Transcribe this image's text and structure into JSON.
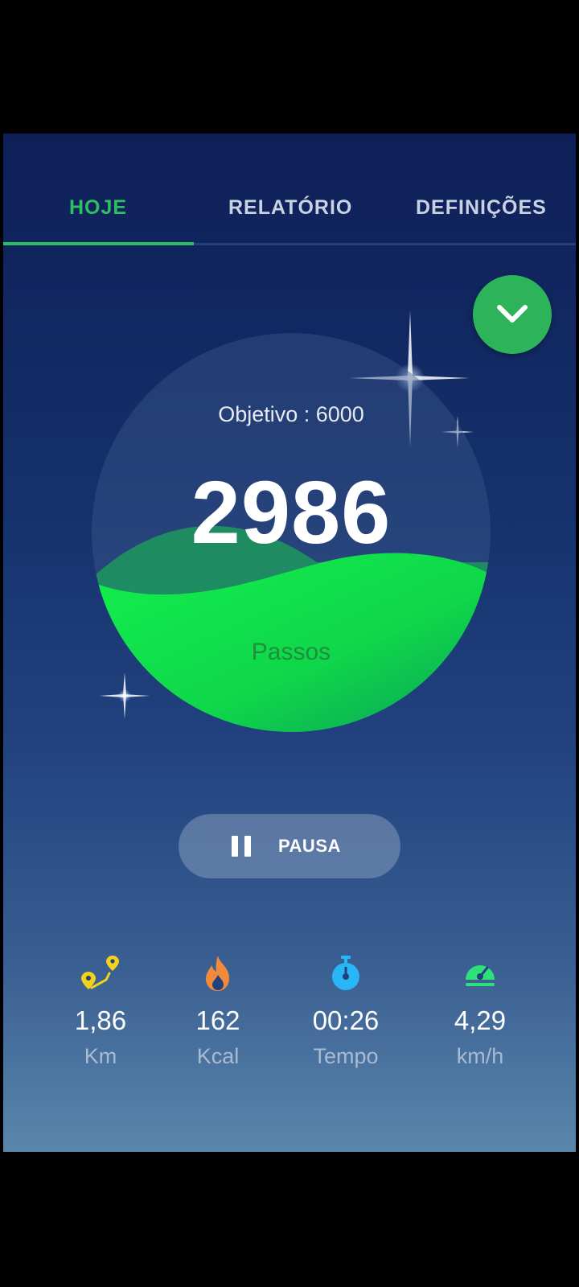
{
  "tabs": [
    {
      "label": "HOJE",
      "active": true
    },
    {
      "label": "RELATÓRIO",
      "active": false
    },
    {
      "label": "DEFINIÇÕES",
      "active": false
    }
  ],
  "accent_color": "#2fbf63",
  "fab": {
    "icon": "chevron-down-icon"
  },
  "goal_label": "Objetivo : 6000",
  "steps": {
    "count": "2986",
    "label": "Passos",
    "goal": 6000
  },
  "pause_button": {
    "label": "PAUSA",
    "icon": "pause-icon"
  },
  "stats": [
    {
      "icon": "route-pin-icon",
      "value": "1,86",
      "unit": "Km",
      "color": "#f2d21b"
    },
    {
      "icon": "flame-icon",
      "value": "162",
      "unit": "Kcal",
      "color": "#f28a3b"
    },
    {
      "icon": "stopwatch-icon",
      "value": "00:26",
      "unit": "Tempo",
      "color": "#29b6f6"
    },
    {
      "icon": "speedometer-icon",
      "value": "4,29",
      "unit": "km/h",
      "color": "#2ee07a"
    }
  ]
}
